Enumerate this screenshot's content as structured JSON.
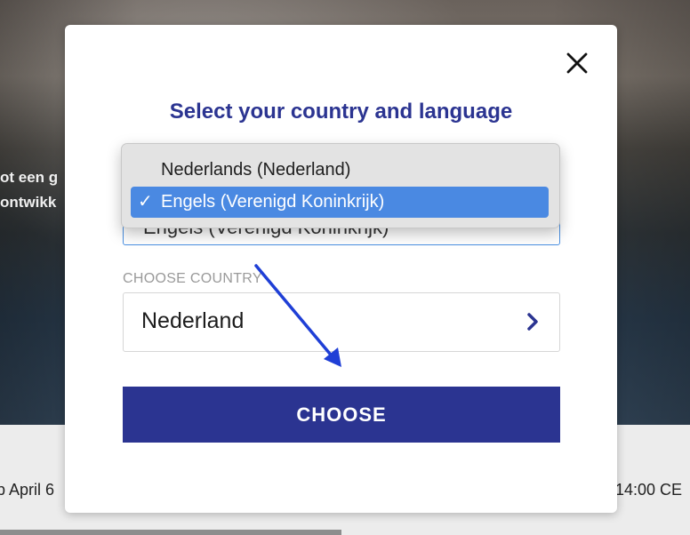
{
  "background": {
    "hero_text_line1": "ot een g",
    "hero_text_line2": "ontwikk",
    "date_left": "p April 6",
    "time_right": "14:00 CE"
  },
  "modal": {
    "title": "Select your country and language",
    "close_icon": "close-icon",
    "language_select": {
      "value": "Engels (Verenigd Koninkrijk)",
      "options": [
        {
          "label": "Nederlands (Nederland)",
          "selected": false
        },
        {
          "label": "Engels (Verenigd Koninkrijk)",
          "selected": true
        }
      ],
      "check_glyph": "✓"
    },
    "country": {
      "label": "CHOOSE COUNTRY",
      "value": "Nederland",
      "chevron_icon": "chevron-right-icon"
    },
    "choose_button": "CHOOSE"
  },
  "colors": {
    "accent": "#2b3491",
    "selected_option": "#4a89e2",
    "annotation_arrow": "#1f3fd6"
  }
}
